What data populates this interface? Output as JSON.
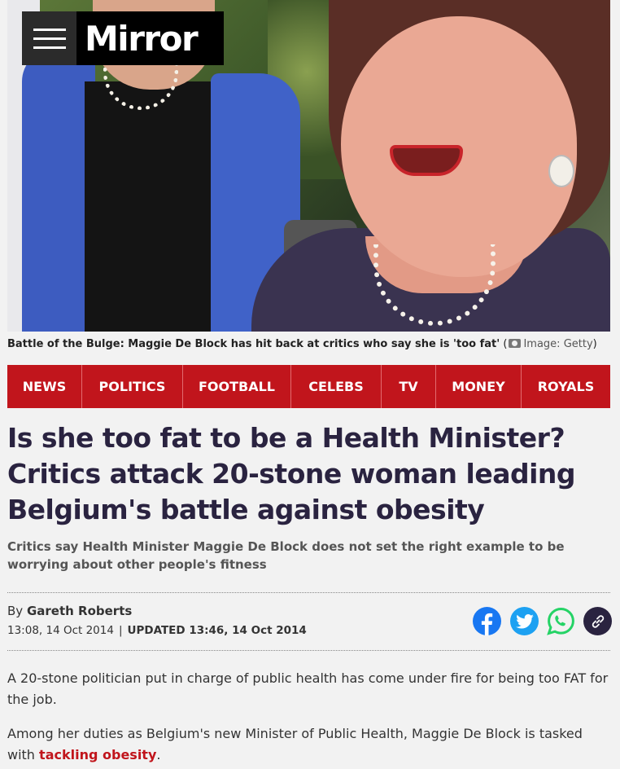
{
  "header": {
    "logo_text": "Mirror",
    "menu_icon": "hamburger-menu-icon"
  },
  "hero": {
    "caption_bold": "Battle of the Bulge: Maggie De Block has hit back at critics who say she is 'too fat'",
    "caption_credit": "Image: Getty",
    "credit_icon": "camera-icon"
  },
  "nav": {
    "items": [
      {
        "label": "NEWS"
      },
      {
        "label": "POLITICS"
      },
      {
        "label": "FOOTBALL"
      },
      {
        "label": "CELEBS"
      },
      {
        "label": "TV"
      },
      {
        "label": "MONEY"
      },
      {
        "label": "ROYALS"
      }
    ],
    "color": "#c1151c"
  },
  "article": {
    "headline": "Is she too fat to be a Health Minister? Critics attack 20-stone woman leading Belgium's battle against obesity",
    "standfirst": "Critics say Health Minister Maggie De Block does not set the right example to be worrying about other people's fitness",
    "by_prefix": "By",
    "author": "Gareth Roberts",
    "published": "13:08, 14 Oct 2014",
    "separator": "|",
    "updated": "UPDATED 13:46, 14 Oct 2014",
    "paragraph1": "A 20-stone politician put in charge of public health has come under fire for being too FAT for the job.",
    "paragraph2_text": "Among her duties as Belgium's new Minister of Public Health, Maggie De Block is tasked with",
    "paragraph2_link": "tackling obesity",
    "paragraph2_end": "."
  },
  "share": {
    "facebook": {
      "icon": "facebook-icon",
      "color": "#1877f2"
    },
    "twitter": {
      "icon": "twitter-icon",
      "color": "#1da1f2"
    },
    "whatsapp": {
      "icon": "whatsapp-icon",
      "color": "#25d366"
    },
    "link": {
      "icon": "link-icon",
      "color": "#2a2340"
    }
  }
}
